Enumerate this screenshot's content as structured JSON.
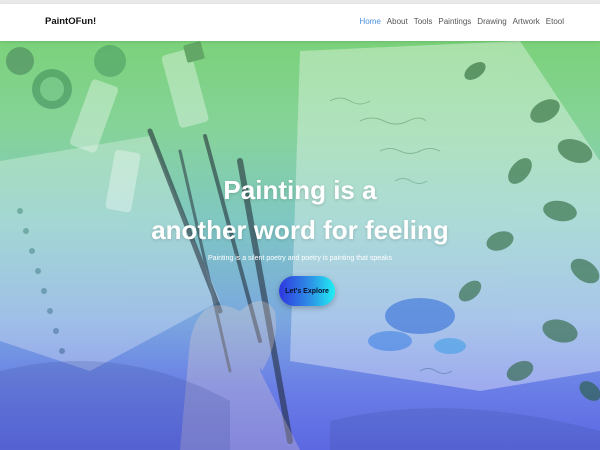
{
  "navbar": {
    "brand": "PaintOFun!",
    "links": [
      "Home",
      "About",
      "Tools",
      "Paintings",
      "Drawing",
      "Artwork",
      "Etool"
    ],
    "active_link": "Home"
  },
  "hero": {
    "title_line1": "Painting is a",
    "title_line2": "another word for feeling",
    "subtitle": "Painting is a silent poetry and poetry is painting that speaks",
    "cta_label": "Let's Explore"
  },
  "colors": {
    "active_link": "#4a90e2",
    "gradient_top": "#7bd27a",
    "gradient_bottom": "#5c68e2",
    "cta_start": "#2f36e0",
    "cta_end": "#1ff0f4"
  }
}
